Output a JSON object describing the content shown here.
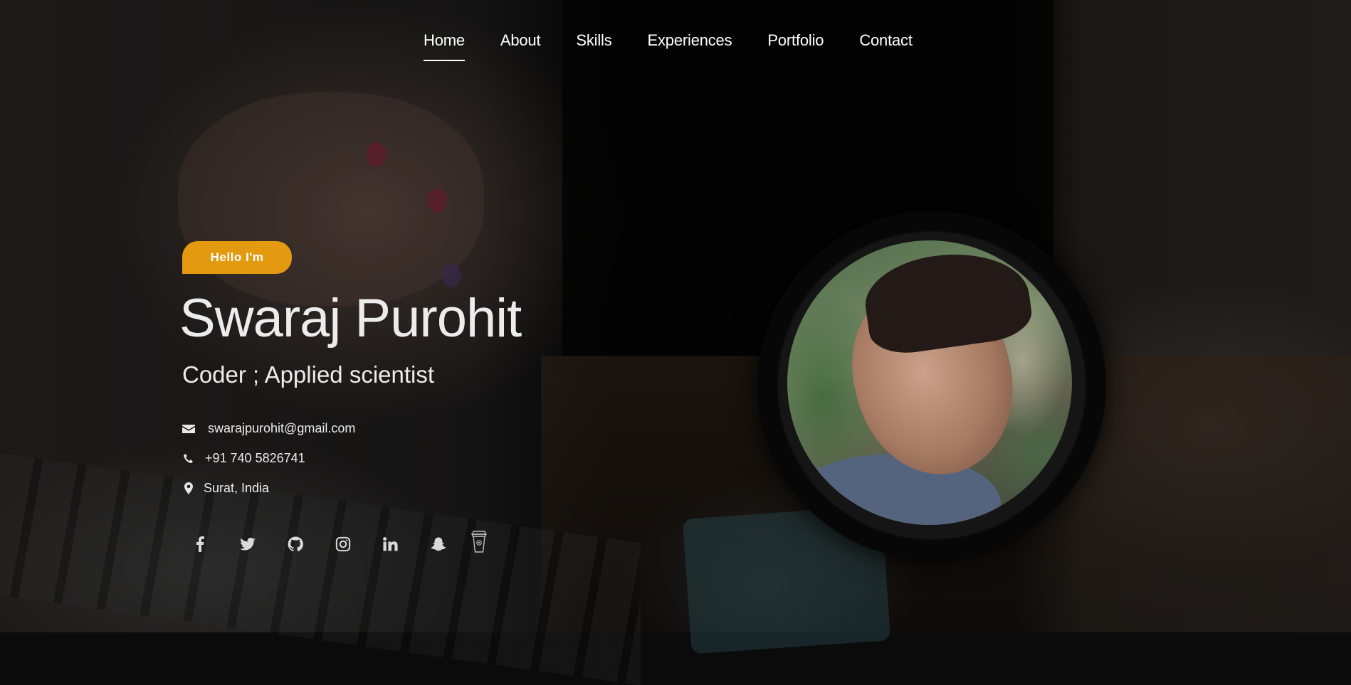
{
  "nav": {
    "items": [
      {
        "label": "Home",
        "active": true
      },
      {
        "label": "About",
        "active": false
      },
      {
        "label": "Skills",
        "active": false
      },
      {
        "label": "Experiences",
        "active": false
      },
      {
        "label": "Portfolio",
        "active": false
      },
      {
        "label": "Contact",
        "active": false
      }
    ]
  },
  "hero": {
    "greeting": "Hello I'm",
    "name": "Swaraj Purohit",
    "title": "Coder ; Applied scientist"
  },
  "contact": {
    "email": "swarajpurohit@gmail.com",
    "phone": "+91 740 5826741",
    "location": "Surat, India"
  },
  "icons": {
    "email": "envelope-icon",
    "phone": "phone-icon",
    "location": "map-marker-icon"
  },
  "socials": [
    {
      "name": "facebook-icon"
    },
    {
      "name": "twitter-icon"
    },
    {
      "name": "github-icon"
    },
    {
      "name": "instagram-icon"
    },
    {
      "name": "linkedin-icon"
    },
    {
      "name": "snapchat-icon"
    },
    {
      "name": "buy-me-a-coffee-icon"
    }
  ],
  "colors": {
    "accent": "#e39a10",
    "text": "#ececec",
    "background": "#0b0b0b"
  }
}
